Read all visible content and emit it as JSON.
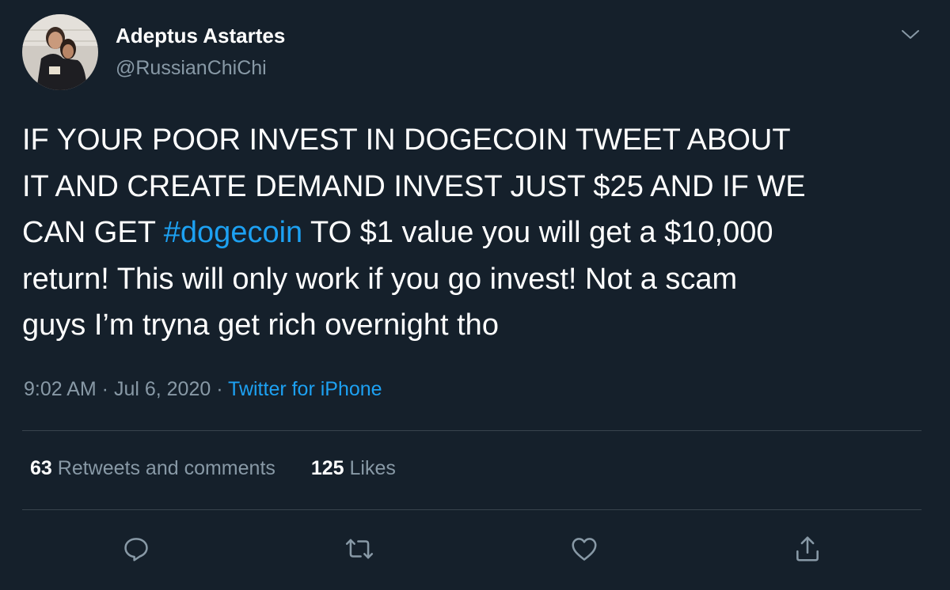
{
  "tweet": {
    "display_name": "Adeptus Astartes",
    "handle": "@RussianChiChi",
    "avatar": "user-avatar-photo",
    "text_before_hashtag": "IF YOUR POOR INVEST IN DOGECOIN TWEET ABOUT\nIT AND CREATE DEMAND INVEST JUST $25 AND IF WE\nCAN GET ",
    "hashtag": "#dogecoin",
    "text_after_hashtag": " TO $1 value you will get a $10,000\nreturn! This will only work if you go invest! Not a scam\nguys I’m tryna get rich overnight tho",
    "time": "9:02 AM",
    "separator": " · ",
    "date": "Jul 6, 2020",
    "source": "Twitter for iPhone"
  },
  "stats": {
    "retweets_count": "63",
    "retweets_label": "Retweets and comments",
    "likes_count": "125",
    "likes_label": "Likes"
  },
  "actions": {
    "reply_icon": "reply-icon",
    "retweet_icon": "retweet-icon",
    "like_icon": "heart-icon",
    "share_icon": "share-icon"
  },
  "colors": {
    "background": "#15202b",
    "text_primary": "#ffffff",
    "text_secondary": "#8899a6",
    "accent": "#1da1f2",
    "divider": "#38444d"
  }
}
